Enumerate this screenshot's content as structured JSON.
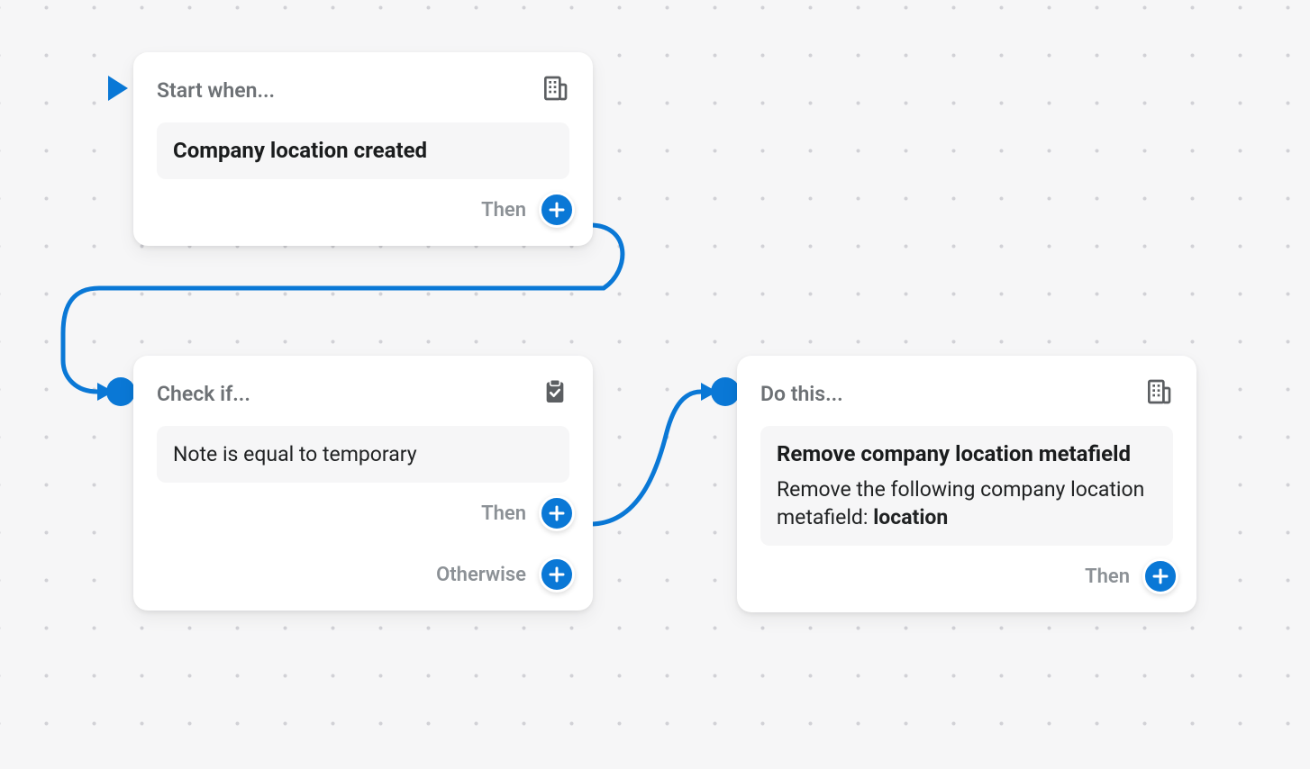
{
  "colors": {
    "accent": "#0a78d6",
    "muted": "#8c9196",
    "text": "#202223"
  },
  "labels": {
    "then": "Then",
    "otherwise": "Otherwise"
  },
  "nodes": {
    "trigger": {
      "title": "Start when...",
      "event": "Company location created",
      "icon": "building-icon"
    },
    "condition": {
      "title": "Check if...",
      "expression": "Note is equal to temporary",
      "icon": "clipboard-check-icon"
    },
    "action": {
      "title": "Do this...",
      "heading": "Remove company location metafield",
      "description_prefix": "Remove the following company location metafield: ",
      "description_value": "location",
      "icon": "building-icon"
    }
  }
}
